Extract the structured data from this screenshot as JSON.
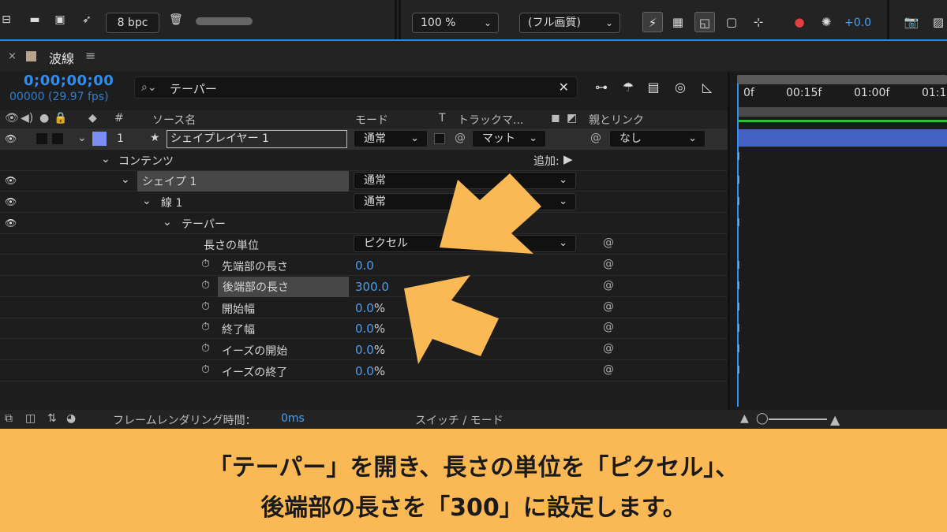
{
  "toolbar": {
    "bpc": "8 bpc",
    "zoom": "100 %",
    "quality": "(フル画質)",
    "exposure": "+0.0"
  },
  "tab": {
    "close": "×",
    "name": "波線",
    "menu": "≡"
  },
  "comp": {
    "timecode": "0;00;00;00",
    "frames": "00000 (29.97 fps)"
  },
  "search": {
    "value": "テーパー",
    "clear": "✕"
  },
  "columns": {
    "source_name": "ソース名",
    "mode": "モード",
    "t": "T",
    "track_matte": "トラックマ...",
    "parent_link": "親とリンク",
    "number": "#"
  },
  "layer": {
    "index": "1",
    "name": "シェイプレイヤー 1",
    "mode": "通常",
    "matte": "マット",
    "parent": "なし",
    "color": "#7b8ef0"
  },
  "tree": {
    "contents": "コンテンツ",
    "add": "追加:",
    "shape1": "シェイプ 1",
    "shape1_mode": "通常",
    "stroke1": "線 1",
    "stroke1_mode": "通常",
    "taper": "テーパー",
    "length_units": "長さの単位",
    "length_units_value": "ピクセル",
    "props": [
      {
        "label": "先端部の長さ",
        "value": "0.0",
        "unit": ""
      },
      {
        "label": "後端部の長さ",
        "value": "300.0",
        "unit": ""
      },
      {
        "label": "開始幅",
        "value": "0.0",
        "unit": "%"
      },
      {
        "label": "終了幅",
        "value": "0.0",
        "unit": "%"
      },
      {
        "label": "イーズの開始",
        "value": "0.0",
        "unit": "%"
      },
      {
        "label": "イーズの終了",
        "value": "0.0",
        "unit": "%"
      }
    ]
  },
  "timeline": {
    "ticks": [
      "0f",
      "00:15f",
      "01:00f",
      "01:1"
    ]
  },
  "footer": {
    "render_label": "フレームレンダリング時間：",
    "render_value": "0ms",
    "switch_mode": "スイッチ / モード"
  },
  "caption": {
    "line1": "「テーパー」を開き、長さの単位を「ピクセル」、",
    "line2": "後端部の長さを「300」に設定します。"
  },
  "colors": {
    "accent": "#2f8ef0",
    "arrow": "#fbb955",
    "caption_bg": "#fbb955"
  }
}
